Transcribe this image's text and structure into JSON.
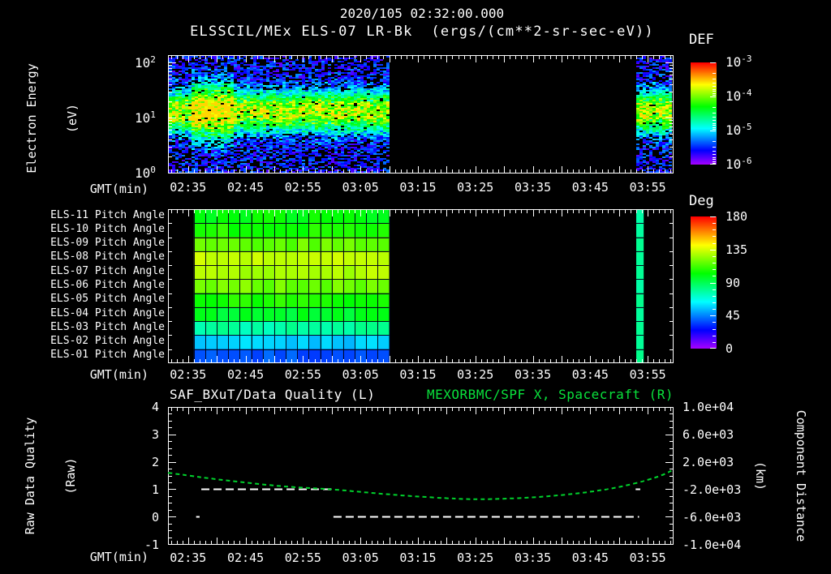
{
  "colors": {
    "background": "#000000",
    "text": "#ffffff",
    "frame": "#ffffff",
    "title_green": "#0ae23c",
    "curve_green": "#00d22c",
    "quality_white": "#ffffff"
  },
  "titles": {
    "datetime": "2020/105 02:32:00.000",
    "main": "ELSSCIL/MEx ELS-07 LR-Bk  (ergs/(cm**2-sr-sec-eV))"
  },
  "axis_x": {
    "label": "GMT(min)",
    "epoch": "02:30",
    "range_minutes": [
      1.5,
      89.5
    ],
    "tick_minutes": [
      5,
      15,
      25,
      35,
      45,
      55,
      65,
      75,
      85
    ],
    "tick_labels": [
      "02:35",
      "02:45",
      "02:55",
      "03:05",
      "03:15",
      "03:25",
      "03:35",
      "03:45",
      "03:55"
    ],
    "minor_step_min": 1,
    "major_step_min": 5
  },
  "panel_energy": {
    "ylabel": [
      "Electron Energy",
      "(eV)"
    ],
    "yticks": [
      {
        "base": "10",
        "exp": "2",
        "log": 2
      },
      {
        "base": "10",
        "exp": "1",
        "log": 1
      },
      {
        "base": "10",
        "exp": "0",
        "log": 0
      }
    ],
    "colorbar": {
      "title": "DEF",
      "ticks": [
        {
          "base": "10",
          "exp": "-3"
        },
        {
          "base": "10",
          "exp": "-4"
        },
        {
          "base": "10",
          "exp": "-5"
        },
        {
          "base": "10",
          "exp": "-6"
        }
      ]
    },
    "segments": [
      {
        "t": [
          1.5,
          39.85
        ],
        "hot": [
          5.5,
          12.5
        ]
      },
      {
        "t": [
          83.0,
          89.2
        ]
      }
    ],
    "band": {
      "center_log10_ev": 1.12,
      "sigma_log10": 0.26
    }
  },
  "panel_pitch": {
    "rows": [
      {
        "label": "ELS-11 Pitch Angle",
        "deg": 102
      },
      {
        "label": "ELS-10 Pitch Angle",
        "deg": 107
      },
      {
        "label": "ELS-09 Pitch Angle",
        "deg": 118
      },
      {
        "label": "ELS-08 Pitch Angle",
        "deg": 132
      },
      {
        "label": "ELS-07 Pitch Angle",
        "deg": 130
      },
      {
        "label": "ELS-06 Pitch Angle",
        "deg": 120
      },
      {
        "label": "ELS-05 Pitch Angle",
        "deg": 107
      },
      {
        "label": "ELS-04 Pitch Angle",
        "deg": 97
      },
      {
        "label": "ELS-03 Pitch Angle",
        "deg": 78
      },
      {
        "label": "ELS-02 Pitch Angle",
        "deg": 57
      },
      {
        "label": "ELS-01 Pitch Angle",
        "deg": 38
      }
    ],
    "colorbar": {
      "title": "Deg",
      "ticks": [
        "180",
        "135",
        "90",
        "45",
        "0"
      ],
      "range": [
        0,
        180
      ]
    },
    "block_t": [
      6.0,
      40.0
    ],
    "strip_t": [
      83.0,
      84.3
    ],
    "strip_deg": 80,
    "cell_minutes": 2
  },
  "panel_quality": {
    "title_left": "SAF_BXuT/Data Quality (L)",
    "title_right": "MEXORBMC/SPF X, Spacecraft (R)",
    "ylabel_left": [
      "Raw Data Quality",
      "(Raw)"
    ],
    "ylabel_right": [
      "Component Distance",
      "(km)"
    ],
    "yticks_left": [
      "4",
      "3",
      "2",
      "1",
      "0",
      "-1"
    ],
    "yrange_left": [
      -1,
      4
    ],
    "yticks_right": [
      "1.0e+04",
      "6.0e+03",
      "2.0e+03",
      "-2.0e+03",
      "-6.0e+03",
      "-1.0e+04"
    ],
    "yrange_right": [
      -10000,
      10000
    ],
    "quality_segments": [
      {
        "level": 1,
        "t": [
          7.3,
          30.0
        ]
      },
      {
        "level": 0,
        "t": [
          6.4,
          7.0
        ]
      },
      {
        "level": 0,
        "t": [
          30.3,
          83.5
        ]
      },
      {
        "level": 1,
        "t": [
          82.9,
          83.7
        ]
      }
    ],
    "curve": {
      "t": [
        1.5,
        5,
        10,
        15,
        20,
        25,
        30,
        35,
        40,
        45,
        50,
        53,
        56,
        60,
        65,
        70,
        75,
        80,
        85,
        88,
        89.5
      ],
      "left": [
        1.6,
        1.5,
        1.36,
        1.24,
        1.13,
        1.05,
        1.0,
        0.9,
        0.81,
        0.73,
        0.67,
        0.64,
        0.63,
        0.65,
        0.7,
        0.78,
        0.9,
        1.07,
        1.33,
        1.55,
        1.72
      ]
    }
  },
  "chart_data": [
    {
      "type": "heatmap",
      "title": "ELSSCIL/MEx ELS-07 LR-Bk",
      "units": "ergs/(cm**2-sr-sec-eV)",
      "timestamp": "2020/105 02:32:00.000",
      "xlabel": "GMT(min)",
      "x_ticks": [
        "02:35",
        "02:45",
        "02:55",
        "03:05",
        "03:15",
        "03:25",
        "03:35",
        "03:45",
        "03:55"
      ],
      "x_range": [
        "02:31:30",
        "03:59:30"
      ],
      "ylabel": "Electron Energy (eV)",
      "y_scale": "log",
      "y_ticks": [
        1,
        10,
        100
      ],
      "colorbar": {
        "label": "DEF",
        "scale": "log",
        "tick_values": [
          0.001,
          0.0001,
          1e-05,
          1e-06
        ]
      },
      "data_coverage": [
        [
          "02:31:30",
          "03:10:00"
        ],
        [
          "03:53:00",
          "03:59:00"
        ]
      ],
      "features": [
        {
          "desc": "intense electron band",
          "energy_ev": [
            6,
            30
          ],
          "peak_def": "~1e-4",
          "time": [
            "02:31:30",
            "03:10:00"
          ]
        },
        {
          "desc": "yellow-green hotspot",
          "energy_ev": [
            8,
            25
          ],
          "peak_def": "~4e-4",
          "time": [
            "02:37",
            "02:43"
          ]
        },
        {
          "desc": "blue/violet noise background",
          "def": "~1e-6 to 1e-5"
        }
      ]
    },
    {
      "type": "heatmap",
      "title": "ELS anode pitch angles",
      "xlabel": "GMT(min)",
      "x_ticks": [
        "02:35",
        "02:45",
        "02:55",
        "03:05",
        "03:15",
        "03:25",
        "03:35",
        "03:45",
        "03:55"
      ],
      "colorbar": {
        "label": "Deg",
        "range": [
          0,
          180
        ],
        "tick_values": [
          180,
          135,
          90,
          45,
          0
        ]
      },
      "data_coverage": [
        [
          "02:36",
          "03:10"
        ],
        [
          "03:53",
          "03:54"
        ]
      ],
      "rows": [
        {
          "name": "ELS-11",
          "pitch_deg": 102
        },
        {
          "name": "ELS-10",
          "pitch_deg": 107
        },
        {
          "name": "ELS-09",
          "pitch_deg": 118
        },
        {
          "name": "ELS-08",
          "pitch_deg": 132
        },
        {
          "name": "ELS-07",
          "pitch_deg": 130
        },
        {
          "name": "ELS-06",
          "pitch_deg": 120
        },
        {
          "name": "ELS-05",
          "pitch_deg": 107
        },
        {
          "name": "ELS-04",
          "pitch_deg": 97
        },
        {
          "name": "ELS-03",
          "pitch_deg": 78
        },
        {
          "name": "ELS-02",
          "pitch_deg": 57
        },
        {
          "name": "ELS-01",
          "pitch_deg": 38
        }
      ],
      "strip_pitch_deg": 80
    },
    {
      "type": "line",
      "xlabel": "GMT(min)",
      "x_ticks": [
        "02:35",
        "02:45",
        "02:55",
        "03:05",
        "03:15",
        "03:25",
        "03:35",
        "03:45",
        "03:55"
      ],
      "left_axis": {
        "label": "Raw Data Quality (Raw)",
        "range": [
          -1,
          4
        ],
        "ticks": [
          4,
          3,
          2,
          1,
          0,
          -1
        ]
      },
      "right_axis": {
        "label": "Component Distance (km)",
        "range": [
          -10000,
          10000
        ],
        "ticks": [
          10000,
          6000,
          2000,
          -2000,
          -6000,
          -10000
        ]
      },
      "series": [
        {
          "name": "SAF_BXuT/Data Quality (L)",
          "axis": "left",
          "style": "white dashed step",
          "segments": [
            {
              "value": 1,
              "from": "02:37:20",
              "to": "03:00:00"
            },
            {
              "value": 0,
              "from": "02:36:25",
              "to": "02:37:00"
            },
            {
              "value": 0,
              "from": "03:00:20",
              "to": "03:53:30"
            },
            {
              "value": 1,
              "from": "03:52:55",
              "to": "03:53:40"
            }
          ]
        },
        {
          "name": "MEXORBMC/SPF X, Spacecraft (R)",
          "axis": "right",
          "style": "green dashed",
          "x_minutes_after_0230": [
            1.5,
            5,
            10,
            15,
            20,
            25,
            30,
            35,
            40,
            45,
            50,
            53,
            56,
            60,
            65,
            70,
            75,
            80,
            85,
            88,
            89.5
          ],
          "km": [
            400,
            0,
            -560,
            -1040,
            -1480,
            -1800,
            -2000,
            -2400,
            -2760,
            -3080,
            -3320,
            -3440,
            -3480,
            -3400,
            -3200,
            -2880,
            -2400,
            -1720,
            -680,
            200,
            880
          ]
        }
      ]
    }
  ]
}
